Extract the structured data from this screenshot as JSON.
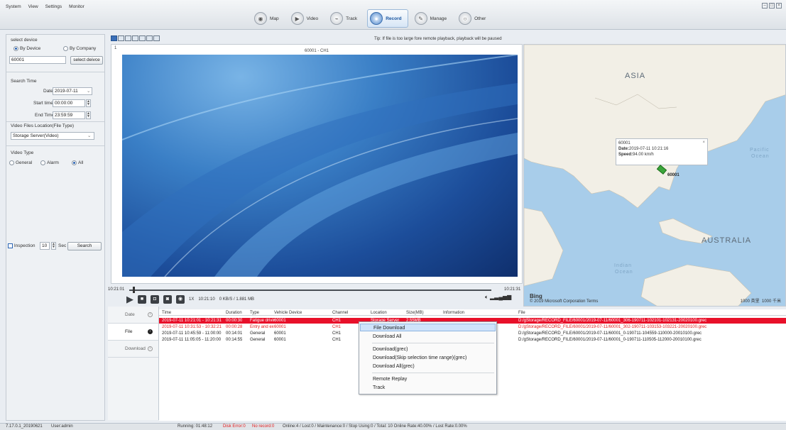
{
  "menu": [
    "System",
    "View",
    "Settings",
    "Monitor"
  ],
  "modules": [
    {
      "label": "Map",
      "icon": "map-icon",
      "glyph": "◉",
      "active": false
    },
    {
      "label": "Video",
      "icon": "video-icon",
      "glyph": "▶",
      "active": false
    },
    {
      "label": "Track",
      "icon": "track-icon",
      "glyph": "⌁",
      "active": false
    },
    {
      "label": "Record",
      "icon": "record-icon",
      "glyph": "●",
      "active": true
    },
    {
      "label": "Manage",
      "icon": "manage-icon",
      "glyph": "✎",
      "active": false
    },
    {
      "label": "Other",
      "icon": "other-icon",
      "glyph": "○",
      "active": false
    }
  ],
  "left": {
    "select_device": "select device",
    "by_device": "By Device",
    "by_company": "By Company",
    "device_value": "60001",
    "select_device_btn": "select deivce",
    "search_time": "Search Time",
    "date_label": "Date",
    "date_value": "2019-07-11",
    "start_label": "Start time",
    "start_value": "00:00:00",
    "end_label": "End Time",
    "end_value": "23:59:59",
    "file_location_label": "Video Files Location(File Type)",
    "file_location_value": "Storage Server(Video)",
    "video_type_label": "Video Type",
    "type_general": "General",
    "type_alarm": "Alarm",
    "type_all": "All",
    "inspection_label": "Inspection",
    "inspection_value": "10",
    "sec_label": "Sec",
    "search_btn": "Search"
  },
  "video": {
    "tip": "Tip: If file is too large fore remote playback, playback will be paused",
    "pane_number": "1",
    "pane_title": "60001 - CH1",
    "time_start": "10:21:01",
    "time_end": "10:21:31",
    "speed": "1X",
    "current_time": "10:21:10",
    "rate": "0 KB/S / 1.881 MB",
    "progress": 0.01
  },
  "map": {
    "asia": "ASIA",
    "australia": "AUSTRALIA",
    "pacific": "Pacific",
    "ocean": "Ocean",
    "indian": "Indian",
    "indian_ocean": "Ocean",
    "popup_id": "60001",
    "popup_date_label": "Date:",
    "popup_date": "2019-07-11 10:21:16",
    "popup_speed_label": "Speed:",
    "popup_speed": "94.00 km/h",
    "marker_label": "60001",
    "bing": "Bing",
    "copyright": "© 2019 Microsoft Corporation Terms",
    "scale1": "1000 英里",
    "scale2": "1000 千米"
  },
  "tabs": [
    {
      "label": "Date",
      "active": false
    },
    {
      "label": "File",
      "active": true
    },
    {
      "label": "Download",
      "active": false
    }
  ],
  "table": {
    "headers": [
      "Time",
      "Duration",
      "Type",
      "Vehicle Device",
      "Channel",
      "Location",
      "Size(MB)",
      "Information",
      "File"
    ],
    "rows": [
      {
        "cells": [
          "2019-07-11 10:21:01 - 10:21:31",
          "00:00:30",
          "Fatigue driving",
          "60001",
          "CH1",
          "Storage Server",
          "2.55MB",
          "",
          "D:/gStorage/RECORD_FILE/60001/2019-07-11/60001_306-190711-102101-102131-20020100.grec"
        ],
        "style": "sel"
      },
      {
        "cells": [
          "2019-07-11 10:31:53 - 10:32:21",
          "00:00:28",
          "Entry and exit",
          "60001",
          "CH1",
          "",
          "",
          "",
          "D:/gStorage/RECORD_FILE/60001/2019-07-11/60001_302-190711-103153-103221-20020100.grec"
        ],
        "style": "red"
      },
      {
        "cells": [
          "2019-07-11 10:45:59 - 11:00:00",
          "00:14:01",
          "General",
          "60001",
          "CH1",
          "",
          "",
          "",
          "D:/gStorage/RECORD_FILE/60001/2019-07-11/60001_0-190711-104559-110000-20010100.grec"
        ],
        "style": ""
      },
      {
        "cells": [
          "2019-07-11 11:05:05 - 11:20:00",
          "00:14:55",
          "General",
          "60001",
          "CH1",
          "",
          "",
          "",
          "D:/gStorage/RECORD_FILE/60001/2019-07-11/60001_0-190711-110505-112000-20010100.grec"
        ],
        "style": ""
      }
    ]
  },
  "context_menu": [
    "File Download",
    "Download All",
    "Download(grec)",
    "Download(Skip selection time range)(grec)",
    "Download All(grec)",
    "Remote Replay",
    "Track"
  ],
  "status": {
    "version": "7.17.0.1_20190621",
    "user": "User:admin",
    "running": "Running: 01:48:12",
    "disk_error": "Disk Error:0",
    "no_record": "No record:0",
    "summary": "Online:4 / Lost:0 / Maintenance:0 / Stop Using:0 / Total: 10    Online Rate:40.00% / Lost Rate:0.00%"
  }
}
